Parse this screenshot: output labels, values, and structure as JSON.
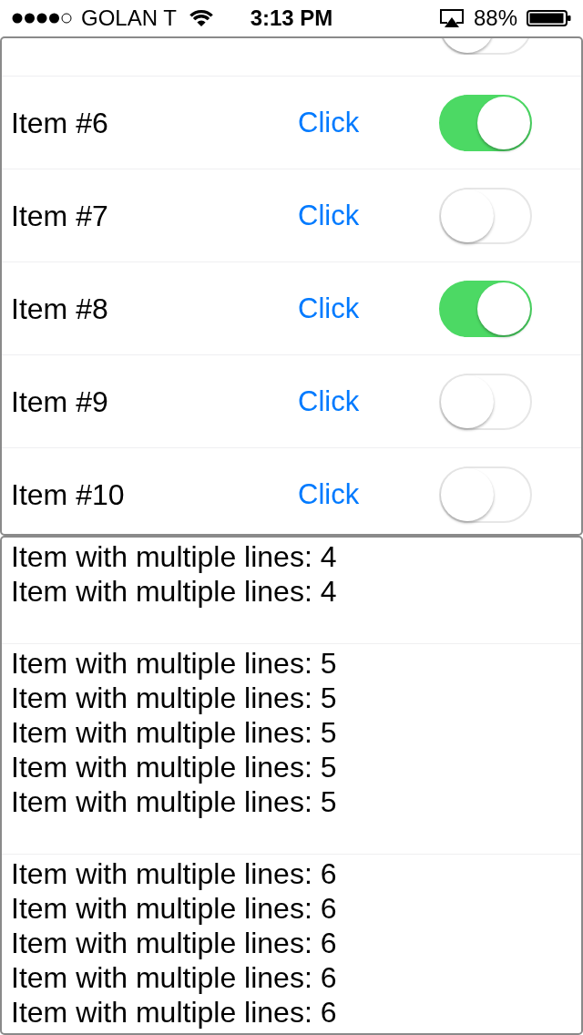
{
  "status_bar": {
    "carrier": "GOLAN T",
    "time": "3:13 PM",
    "battery": "88%"
  },
  "toggle_list": {
    "partial_row": {
      "on": false
    },
    "rows": [
      {
        "label": "Item #6",
        "action": "Click",
        "on": true
      },
      {
        "label": "Item #7",
        "action": "Click",
        "on": false
      },
      {
        "label": "Item #8",
        "action": "Click",
        "on": true
      },
      {
        "label": "Item #9",
        "action": "Click",
        "on": false
      },
      {
        "label": "Item #10",
        "action": "Click",
        "on": false
      }
    ]
  },
  "multiline_list": {
    "items": [
      {
        "lines": [
          "Item with multiple lines: 4",
          "Item with multiple lines: 4"
        ]
      },
      {
        "lines": [
          "Item with multiple lines: 5",
          "Item with multiple lines: 5",
          "Item with multiple lines: 5",
          "Item with multiple lines: 5",
          "Item with multiple lines: 5"
        ]
      },
      {
        "lines": [
          "Item with multiple lines: 6",
          "Item with multiple lines: 6",
          "Item with multiple lines: 6",
          "Item with multiple lines: 6",
          "Item with multiple lines: 6"
        ]
      }
    ]
  }
}
